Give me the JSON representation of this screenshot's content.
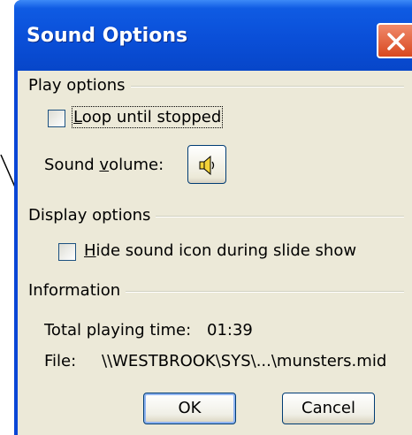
{
  "window": {
    "title": "Sound Options"
  },
  "play_options": {
    "group_label": "Play options",
    "loop": {
      "label_key": "L",
      "label_rest": "oop until stopped",
      "checked": false
    },
    "volume": {
      "label_pre": "Sound ",
      "label_key": "v",
      "label_post": "olume:",
      "icon": "speaker-icon"
    }
  },
  "display_options": {
    "group_label": "Display options",
    "hide_icon": {
      "label_key": "H",
      "label_rest": "ide sound icon during slide show",
      "checked": false
    }
  },
  "information": {
    "group_label": "Information",
    "playing_time_label": "Total playing time:",
    "playing_time_value": "01:39",
    "file_label": "File:",
    "file_value": "\\\\WESTBROOK\\SYS\\...\\munsters.mid"
  },
  "buttons": {
    "ok": "OK",
    "cancel": "Cancel"
  },
  "colors": {
    "titlebar": "#0a4fd8",
    "client": "#ece9d8",
    "close": "#d8481f"
  }
}
